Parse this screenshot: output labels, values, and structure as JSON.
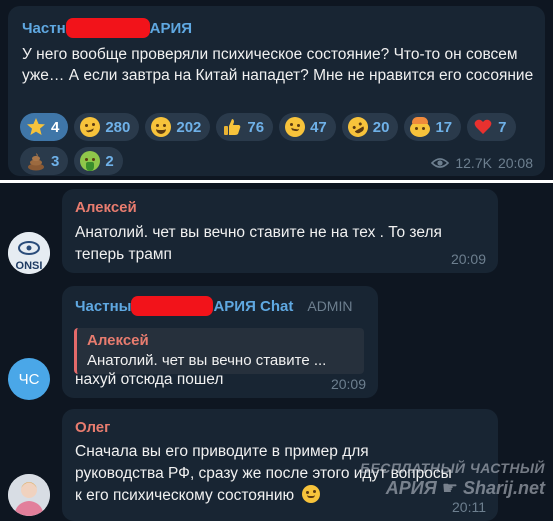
{
  "post": {
    "author_prefix": "Частн",
    "author_suffix": "АРИЯ",
    "text": "У него вообще проверяли психическое состояние? Что-то он совсем уже… А если завтра на Китай нападет? Мне не нравится его сосояние",
    "reactions": [
      {
        "icon": "star-icon",
        "count": "4"
      },
      {
        "icon": "woozy-face-icon",
        "count": "280"
      },
      {
        "icon": "grinning-face-icon",
        "count": "202"
      },
      {
        "icon": "thumbs-up-icon",
        "count": "76"
      },
      {
        "icon": "thinking-face-icon",
        "count": "47"
      },
      {
        "icon": "rofl-face-icon",
        "count": "20"
      },
      {
        "icon": "exploding-head-icon",
        "count": "17"
      },
      {
        "icon": "red-heart-icon",
        "count": "7"
      },
      {
        "icon": "poop-icon",
        "count": "3"
      },
      {
        "icon": "vomiting-face-icon",
        "count": "2"
      }
    ],
    "views": "12.7K",
    "time": "20:08"
  },
  "messages": [
    {
      "author": "Алексей",
      "author_color": "#e87c6f",
      "avatar_text": "ONSI",
      "text_lines": [
        "Анатолий. чет вы вечно ставите не на тех . То зеля",
        "теперь трамп"
      ],
      "time": "20:09"
    },
    {
      "author_prefix": "Частны",
      "author_suffix": "АРИЯ Chat",
      "badge": "ADMIN",
      "avatar_text": "ЧС",
      "reply_author": "Алексей",
      "reply_text": "Анатолий. чет вы вечно ставите ...",
      "text": "нахуй отсюда пошел",
      "time": "20:09"
    },
    {
      "author": "Олег",
      "author_color": "#e87c6f",
      "text_lines": [
        "Сначала вы его приводите в пример для",
        "руководства РФ, сразу же после этого идут вопросы",
        "к его психическому состоянию"
      ],
      "time": "20:11"
    }
  ],
  "watermark": {
    "line1": "БЕСПЛАТНЫЙ ЧАСТНЫЙ",
    "line2": "АРИЯ",
    "site": "Sharij.net"
  },
  "colors": {
    "background": "#0e1621",
    "bubble": "#182533",
    "accent_blue": "#5fa8e1",
    "name_red": "#e87c6f",
    "redaction": "#f2131a"
  }
}
